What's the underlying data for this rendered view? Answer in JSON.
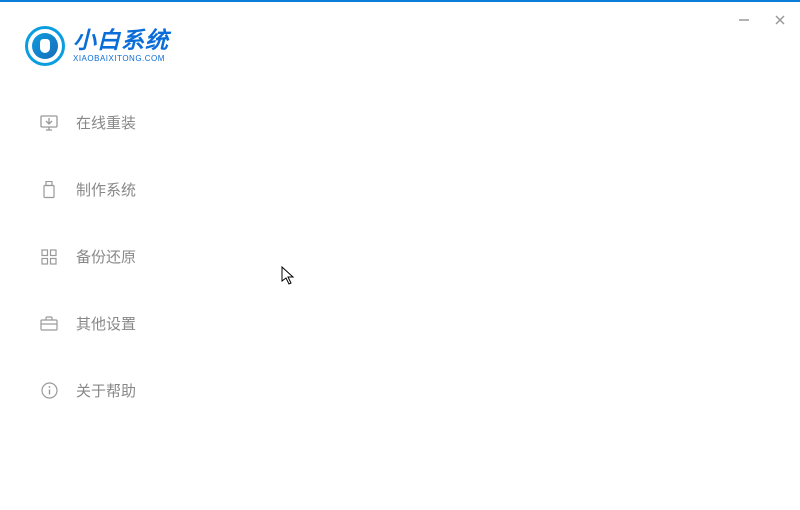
{
  "app": {
    "title": "小白系统",
    "subtitle": "XIAOBAIXITONG.COM"
  },
  "sidebar": {
    "items": [
      {
        "label": "在线重装",
        "icon": "monitor-download-icon"
      },
      {
        "label": "制作系统",
        "icon": "usb-drive-icon"
      },
      {
        "label": "备份还原",
        "icon": "grid-icon"
      },
      {
        "label": "其他设置",
        "icon": "briefcase-icon"
      },
      {
        "label": "关于帮助",
        "icon": "info-icon"
      }
    ]
  }
}
